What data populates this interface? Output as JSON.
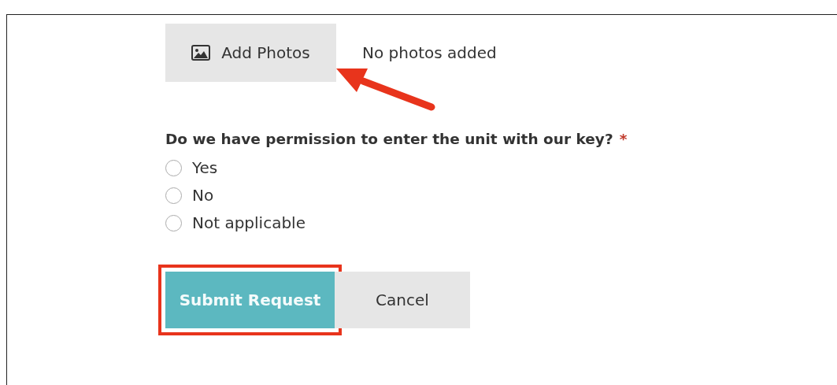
{
  "photos": {
    "button": "Add Photos",
    "status": "No photos added"
  },
  "question": {
    "label": "Do we have permission to enter the unit with our key?",
    "required_mark": "*"
  },
  "options": [
    {
      "label": "Yes",
      "selected": false
    },
    {
      "label": "No",
      "selected": false
    },
    {
      "label": "Not applicable",
      "selected": false
    }
  ],
  "actions": [
    {
      "label": "Submit Request",
      "kind": "primary",
      "highlighted": true
    },
    {
      "label": "Cancel",
      "kind": "secondary",
      "highlighted": false
    }
  ]
}
